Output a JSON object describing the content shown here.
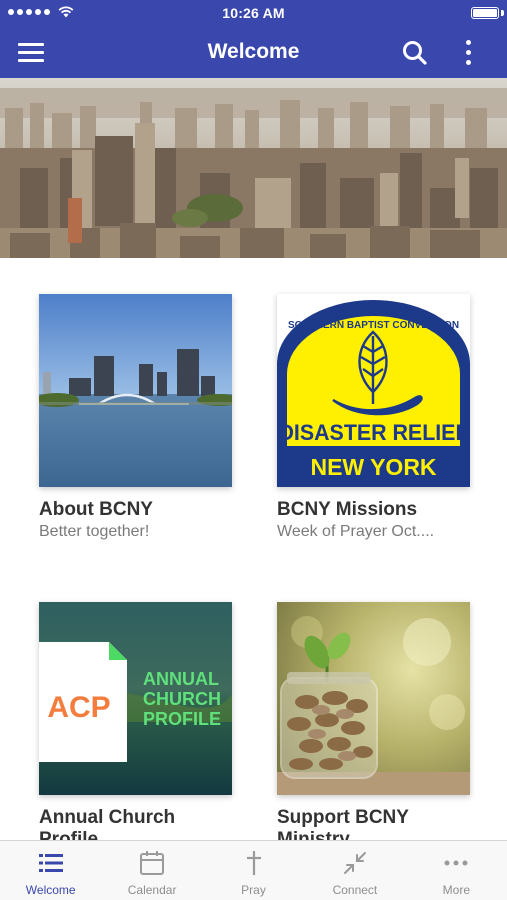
{
  "status_bar": {
    "time": "10:26 AM"
  },
  "app_bar": {
    "title": "Welcome",
    "background_color": "#3a47ad"
  },
  "cards": [
    {
      "title": "About  BCNY",
      "subtitle": "Better together!"
    },
    {
      "title": "BCNY Missions",
      "subtitle": "Week of Prayer Oct....",
      "image_text": {
        "arc": "SOUTHERN BAPTIST CONVENTION",
        "line1": "DISASTER RELIEF",
        "line2": "NEW YORK"
      }
    },
    {
      "title": "Annual Church Profile",
      "subtitle": "",
      "image_text": {
        "badge": "ACP",
        "line1": "ANNUAL",
        "line2": "CHURCH",
        "line3": "PROFILE"
      }
    },
    {
      "title": "Support BCNY Ministry",
      "subtitle": ""
    }
  ],
  "tabs": [
    {
      "label": "Welcome",
      "icon": "list-icon",
      "active": true
    },
    {
      "label": "Calendar",
      "icon": "calendar-icon",
      "active": false
    },
    {
      "label": "Pray",
      "icon": "cross-icon",
      "active": false
    },
    {
      "label": "Connect",
      "icon": "connect-arrows-icon",
      "active": false
    },
    {
      "label": "More",
      "icon": "more-dots-icon",
      "active": false
    }
  ],
  "colors": {
    "accent": "#3a47ad",
    "tab_inactive": "#8e8e8e"
  }
}
